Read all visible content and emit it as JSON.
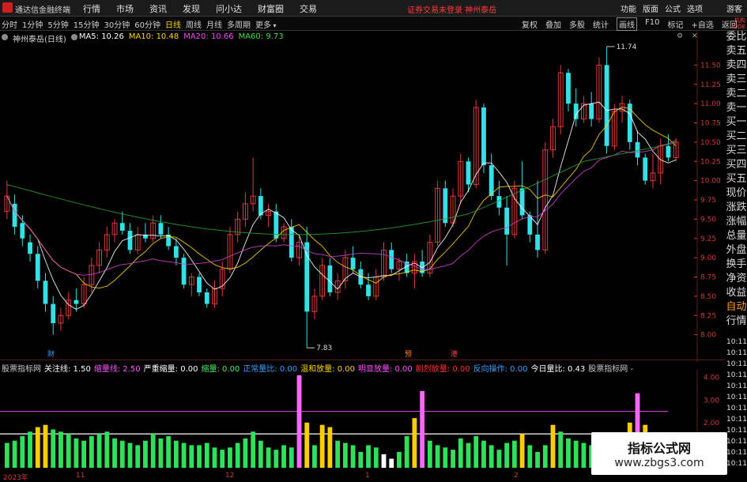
{
  "app": {
    "title": "通达信金融终端",
    "menu": [
      "行情",
      "市场",
      "资讯",
      "发现",
      "问小达",
      "财富圈",
      "交易"
    ],
    "warning": "证券交易未登录 神州泰岳",
    "right_buttons": [
      "功能",
      "版面",
      "公式",
      "选项"
    ],
    "guest": "游客"
  },
  "periods": [
    "分时",
    "1分钟",
    "5分钟",
    "15分钟",
    "30分钟",
    "60分钟",
    "日线",
    "周线",
    "月线",
    "多周期",
    "更多"
  ],
  "active_period": "日线",
  "tools": [
    "复权",
    "叠加",
    "多股",
    "统计",
    "画线",
    "F10",
    "标记",
    "+自选",
    "返回"
  ],
  "tool_selected": "画线",
  "right_top": [
    "机构",
    "IDDE"
  ],
  "stock_label": "神州泰岳(日线)",
  "ma": [
    {
      "label": "MA5: 10.26",
      "color": "#ffffff"
    },
    {
      "label": "MA10: 10.48",
      "color": "#ffd400"
    },
    {
      "label": "MA20: 10.66",
      "color": "#ff44ff"
    },
    {
      "label": "MA60: 9.73",
      "color": "#44dd44"
    }
  ],
  "sidebar": [
    "委比",
    "卖五",
    "卖四",
    "卖三",
    "卖二",
    "卖一",
    "买一",
    "买二",
    "买三",
    "买四",
    "买五",
    "现价",
    "涨跌",
    "涨幅",
    "总量",
    "外盘",
    "换手",
    "净资",
    "收益",
    "自动",
    "行情"
  ],
  "sidebar_hl": [
    "自动"
  ],
  "price_axis": [
    "11.50",
    "11.25",
    "11.00",
    "10.75",
    "10.50",
    "10.25",
    "10.00",
    "9.75",
    "9.50",
    "9.25",
    "9.00",
    "8.75",
    "8.50",
    "8.25",
    "8.00"
  ],
  "annotations": {
    "high": "11.74",
    "low": "7.83"
  },
  "markers": [
    {
      "text": "财",
      "color": "#3aa0ff"
    },
    {
      "text": "预",
      "color": "#ff8800"
    },
    {
      "text": "港",
      "color": "#ff4444"
    }
  ],
  "volume_legend": [
    {
      "text": "股票指标网",
      "color": "#c8c8c8"
    },
    {
      "text": "关注线: 1.50",
      "color": "#ffffff"
    },
    {
      "text": "缩量线: 2.50",
      "color": "#ff55ff"
    },
    {
      "text": "严重缩量: 0.00",
      "color": "#ffffff"
    },
    {
      "text": "缩量: 0.00",
      "color": "#44ee66"
    },
    {
      "text": "正常量比: 0.00",
      "color": "#3aa0ff"
    },
    {
      "text": "温和放量: 0.00",
      "color": "#ffd400"
    },
    {
      "text": "明显放量: 0.00",
      "color": "#ff55ff"
    },
    {
      "text": "剧烈放量: 0.00",
      "color": "#ff3333"
    },
    {
      "text": "反向操作: 0.00",
      "color": "#3aa0ff"
    },
    {
      "text": "今日量比: 0.43",
      "color": "#ffffff"
    },
    {
      "text": "股票指标网 -",
      "color": "#c8c8c8"
    }
  ],
  "volume_axis": [
    "4.00",
    "3.00",
    "2.00"
  ],
  "time_labels": [
    "10:11",
    "10:11",
    "10:11",
    "10:11",
    "10:11",
    "10:11",
    "10:11",
    "10:11",
    "10:11",
    "10:11",
    "10:11",
    "10:11"
  ],
  "dates": [
    "2023年",
    "11",
    "12",
    "1",
    "2"
  ],
  "watermark": {
    "line1": "指标公式网",
    "line2": "www.zbgs3.com"
  },
  "chart_data": {
    "type": "candlestick",
    "ylim": [
      7.75,
      11.75
    ],
    "candles": [
      {
        "o": 9.6,
        "h": 10.0,
        "l": 9.5,
        "c": 9.8
      },
      {
        "o": 9.7,
        "h": 9.82,
        "l": 9.3,
        "c": 9.4
      },
      {
        "o": 9.45,
        "h": 9.55,
        "l": 9.15,
        "c": 9.25
      },
      {
        "o": 9.2,
        "h": 9.3,
        "l": 8.95,
        "c": 9.05
      },
      {
        "o": 9.05,
        "h": 9.15,
        "l": 8.6,
        "c": 8.7
      },
      {
        "o": 8.7,
        "h": 8.8,
        "l": 8.3,
        "c": 8.4
      },
      {
        "o": 8.4,
        "h": 8.5,
        "l": 8.0,
        "c": 8.15
      },
      {
        "o": 8.15,
        "h": 8.35,
        "l": 8.05,
        "c": 8.25
      },
      {
        "o": 8.25,
        "h": 8.55,
        "l": 8.2,
        "c": 8.45
      },
      {
        "o": 8.45,
        "h": 8.6,
        "l": 8.3,
        "c": 8.4
      },
      {
        "o": 8.4,
        "h": 8.75,
        "l": 8.35,
        "c": 8.65
      },
      {
        "o": 8.65,
        "h": 9.0,
        "l": 8.55,
        "c": 8.9
      },
      {
        "o": 8.9,
        "h": 9.2,
        "l": 8.8,
        "c": 9.1
      },
      {
        "o": 9.1,
        "h": 9.4,
        "l": 9.0,
        "c": 9.3
      },
      {
        "o": 9.3,
        "h": 9.5,
        "l": 9.2,
        "c": 9.45
      },
      {
        "o": 9.45,
        "h": 9.6,
        "l": 9.3,
        "c": 9.35
      },
      {
        "o": 9.35,
        "h": 9.45,
        "l": 9.05,
        "c": 9.1
      },
      {
        "o": 9.1,
        "h": 9.4,
        "l": 9.05,
        "c": 9.3
      },
      {
        "o": 9.3,
        "h": 9.45,
        "l": 9.2,
        "c": 9.25
      },
      {
        "o": 9.25,
        "h": 9.55,
        "l": 9.2,
        "c": 9.45
      },
      {
        "o": 9.45,
        "h": 9.55,
        "l": 9.25,
        "c": 9.3
      },
      {
        "o": 9.3,
        "h": 9.4,
        "l": 9.1,
        "c": 9.15
      },
      {
        "o": 9.15,
        "h": 9.25,
        "l": 8.9,
        "c": 9.0
      },
      {
        "o": 9.0,
        "h": 9.05,
        "l": 8.6,
        "c": 8.65
      },
      {
        "o": 8.65,
        "h": 8.8,
        "l": 8.5,
        "c": 8.75
      },
      {
        "o": 8.75,
        "h": 8.8,
        "l": 8.5,
        "c": 8.55
      },
      {
        "o": 8.55,
        "h": 8.6,
        "l": 8.35,
        "c": 8.4
      },
      {
        "o": 8.4,
        "h": 8.7,
        "l": 8.35,
        "c": 8.6
      },
      {
        "o": 8.6,
        "h": 8.95,
        "l": 8.5,
        "c": 8.85
      },
      {
        "o": 8.85,
        "h": 9.4,
        "l": 8.8,
        "c": 9.3
      },
      {
        "o": 9.3,
        "h": 9.6,
        "l": 9.2,
        "c": 9.5
      },
      {
        "o": 9.5,
        "h": 9.85,
        "l": 9.4,
        "c": 9.7
      },
      {
        "o": 9.7,
        "h": 10.3,
        "l": 9.6,
        "c": 9.8
      },
      {
        "o": 9.8,
        "h": 9.9,
        "l": 9.5,
        "c": 9.55
      },
      {
        "o": 9.55,
        "h": 9.7,
        "l": 9.4,
        "c": 9.6
      },
      {
        "o": 9.6,
        "h": 9.7,
        "l": 9.2,
        "c": 9.25
      },
      {
        "o": 9.25,
        "h": 9.45,
        "l": 9.2,
        "c": 9.4
      },
      {
        "o": 9.4,
        "h": 9.5,
        "l": 8.95,
        "c": 9.0
      },
      {
        "o": 9.0,
        "h": 9.3,
        "l": 8.9,
        "c": 9.2
      },
      {
        "o": 9.2,
        "h": 9.4,
        "l": 7.83,
        "c": 8.3
      },
      {
        "o": 8.3,
        "h": 8.6,
        "l": 8.2,
        "c": 8.5
      },
      {
        "o": 8.5,
        "h": 9.0,
        "l": 8.45,
        "c": 8.9
      },
      {
        "o": 8.9,
        "h": 9.0,
        "l": 8.5,
        "c": 8.55
      },
      {
        "o": 8.55,
        "h": 8.8,
        "l": 8.45,
        "c": 8.7
      },
      {
        "o": 8.7,
        "h": 9.1,
        "l": 8.6,
        "c": 9.0
      },
      {
        "o": 9.0,
        "h": 9.15,
        "l": 8.8,
        "c": 8.85
      },
      {
        "o": 8.85,
        "h": 8.95,
        "l": 8.6,
        "c": 8.65
      },
      {
        "o": 8.65,
        "h": 8.8,
        "l": 8.45,
        "c": 8.5
      },
      {
        "o": 8.5,
        "h": 8.85,
        "l": 8.45,
        "c": 8.75
      },
      {
        "o": 8.75,
        "h": 9.2,
        "l": 8.7,
        "c": 9.1
      },
      {
        "o": 9.1,
        "h": 9.2,
        "l": 8.8,
        "c": 8.85
      },
      {
        "o": 8.85,
        "h": 9.0,
        "l": 8.7,
        "c": 8.95
      },
      {
        "o": 8.95,
        "h": 9.05,
        "l": 8.75,
        "c": 8.8
      },
      {
        "o": 8.8,
        "h": 9.05,
        "l": 8.6,
        "c": 8.95
      },
      {
        "o": 8.95,
        "h": 9.1,
        "l": 8.75,
        "c": 8.8
      },
      {
        "o": 8.8,
        "h": 9.3,
        "l": 8.75,
        "c": 9.2
      },
      {
        "o": 9.2,
        "h": 10.0,
        "l": 9.15,
        "c": 9.9
      },
      {
        "o": 9.9,
        "h": 10.0,
        "l": 9.4,
        "c": 9.45
      },
      {
        "o": 9.45,
        "h": 9.9,
        "l": 9.4,
        "c": 9.8
      },
      {
        "o": 9.8,
        "h": 10.35,
        "l": 9.7,
        "c": 10.25
      },
      {
        "o": 10.25,
        "h": 10.3,
        "l": 9.85,
        "c": 9.95
      },
      {
        "o": 9.95,
        "h": 11.05,
        "l": 9.9,
        "c": 10.95
      },
      {
        "o": 10.95,
        "h": 11.0,
        "l": 10.1,
        "c": 10.2
      },
      {
        "o": 10.2,
        "h": 10.35,
        "l": 9.75,
        "c": 9.8
      },
      {
        "o": 9.8,
        "h": 10.0,
        "l": 9.55,
        "c": 9.65
      },
      {
        "o": 9.65,
        "h": 9.8,
        "l": 8.9,
        "c": 9.3
      },
      {
        "o": 9.3,
        "h": 10.0,
        "l": 9.25,
        "c": 9.9
      },
      {
        "o": 9.9,
        "h": 10.25,
        "l": 9.5,
        "c": 9.55
      },
      {
        "o": 9.55,
        "h": 9.6,
        "l": 9.2,
        "c": 9.3
      },
      {
        "o": 9.3,
        "h": 10.0,
        "l": 9.0,
        "c": 9.1
      },
      {
        "o": 9.1,
        "h": 10.5,
        "l": 9.05,
        "c": 10.4
      },
      {
        "o": 10.4,
        "h": 10.8,
        "l": 10.3,
        "c": 10.7
      },
      {
        "o": 10.7,
        "h": 11.5,
        "l": 10.6,
        "c": 11.4
      },
      {
        "o": 11.4,
        "h": 11.45,
        "l": 10.9,
        "c": 11.0
      },
      {
        "o": 11.0,
        "h": 11.2,
        "l": 10.7,
        "c": 10.8
      },
      {
        "o": 10.8,
        "h": 11.1,
        "l": 10.75,
        "c": 11.0
      },
      {
        "o": 11.0,
        "h": 11.15,
        "l": 10.7,
        "c": 10.8
      },
      {
        "o": 10.8,
        "h": 11.6,
        "l": 10.75,
        "c": 11.5
      },
      {
        "o": 11.5,
        "h": 11.74,
        "l": 10.35,
        "c": 10.45
      },
      {
        "o": 10.45,
        "h": 11.0,
        "l": 10.4,
        "c": 10.9
      },
      {
        "o": 10.9,
        "h": 11.1,
        "l": 10.75,
        "c": 11.0
      },
      {
        "o": 11.0,
        "h": 11.05,
        "l": 10.4,
        "c": 10.5
      },
      {
        "o": 10.5,
        "h": 10.65,
        "l": 10.2,
        "c": 10.3
      },
      {
        "o": 10.3,
        "h": 10.35,
        "l": 9.95,
        "c": 10.0
      },
      {
        "o": 10.0,
        "h": 10.35,
        "l": 9.9,
        "c": 10.1
      },
      {
        "o": 10.1,
        "h": 10.55,
        "l": 9.95,
        "c": 10.45
      },
      {
        "o": 10.45,
        "h": 10.6,
        "l": 10.25,
        "c": 10.3
      },
      {
        "o": 10.3,
        "h": 10.55,
        "l": 10.25,
        "c": 10.5
      }
    ],
    "volume_ratio": [
      1.1,
      1.2,
      1.4,
      1.6,
      1.8,
      1.9,
      1.7,
      1.6,
      1.5,
      1.3,
      1.2,
      1.4,
      1.5,
      1.6,
      1.3,
      1.2,
      1.1,
      1.0,
      1.2,
      1.5,
      1.3,
      1.4,
      1.2,
      1.1,
      1.0,
      1.0,
      1.1,
      0.9,
      0.8,
      0.9,
      1.1,
      1.3,
      1.6,
      1.2,
      0.9,
      0.8,
      1.0,
      0.9,
      4.1,
      2.0,
      1.0,
      1.9,
      1.8,
      1.2,
      1.1,
      1.0,
      0.7,
      1.0,
      0.9,
      0.6,
      0.4,
      0.7,
      1.4,
      2.2,
      3.4,
      1.2,
      1.0,
      0.9,
      0.8,
      1.3,
      1.1,
      1.4,
      1.2,
      1.0,
      0.8,
      1.1,
      1.2,
      1.5,
      1.0,
      0.7,
      1.0,
      1.9,
      1.6,
      1.3,
      1.2,
      1.1,
      1.0,
      0.8,
      0.9,
      1.0,
      1.3,
      2.0,
      3.3,
      1.9,
      1.2,
      1.4,
      1.5,
      1.2,
      1.1
    ],
    "volume_colors": [
      "#2ee05a",
      "#2ee05a",
      "#2ee05a",
      "#2ee05a",
      "#ffcc00",
      "#ffcc00",
      "#2ee05a",
      "#2ee05a",
      "#2ee05a",
      "#2ee05a",
      "#2ee05a",
      "#2ee05a",
      "#2ee05a",
      "#2ee05a",
      "#2ee05a",
      "#2ee05a",
      "#2ee05a",
      "#2ee05a",
      "#2ee05a",
      "#2ee05a",
      "#2ee05a",
      "#2ee05a",
      "#2ee05a",
      "#2ee05a",
      "#2ee05a",
      "#2ee05a",
      "#2ee05a",
      "#2ee05a",
      "#2ee05a",
      "#2ee05a",
      "#2ee05a",
      "#2ee05a",
      "#2ee05a",
      "#2ee05a",
      "#2ee05a",
      "#2ee05a",
      "#2ee05a",
      "#2ee05a",
      "#ff66ff",
      "#ffcc00",
      "#2ee05a",
      "#ffcc00",
      "#ffcc00",
      "#2ee05a",
      "#2ee05a",
      "#2ee05a",
      "#2ee05a",
      "#2ee05a",
      "#2ee05a",
      "#ffffff",
      "#ffffff",
      "#2ee05a",
      "#2ee05a",
      "#ffcc00",
      "#ff66ff",
      "#2ee05a",
      "#2ee05a",
      "#2ee05a",
      "#2ee05a",
      "#2ee05a",
      "#2ee05a",
      "#2ee05a",
      "#2ee05a",
      "#2ee05a",
      "#2ee05a",
      "#2ee05a",
      "#2ee05a",
      "#ffcc00",
      "#2ee05a",
      "#2ee05a",
      "#2ee05a",
      "#ffcc00",
      "#2ee05a",
      "#2ee05a",
      "#2ee05a",
      "#2ee05a",
      "#2ee05a",
      "#2ee05a",
      "#2ee05a",
      "#2ee05a",
      "#2ee05a",
      "#ffcc00",
      "#ff66ff",
      "#ffcc00",
      "#2ee05a",
      "#2ee05a",
      "#2ee05a",
      "#2ee05a",
      "#2ee05a"
    ],
    "reference_lines": [
      {
        "value": 1.5,
        "color": "#ffffff"
      },
      {
        "value": 2.5,
        "color": "#cc44cc"
      }
    ],
    "volume_ylim": [
      0,
      4.2
    ]
  }
}
